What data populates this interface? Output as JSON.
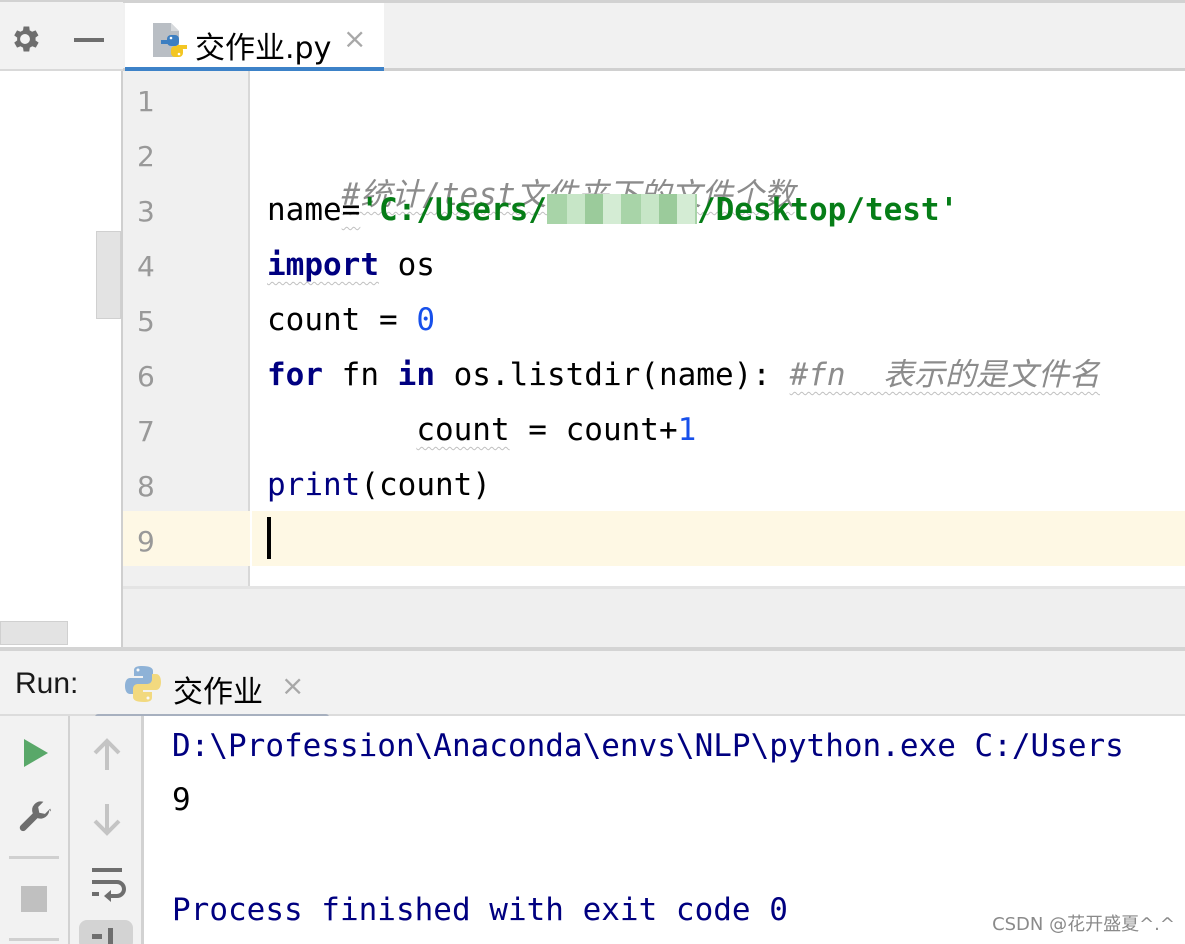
{
  "left_toolbar": {
    "settings_icon": "gear-icon",
    "minimize_icon": "minimize-icon"
  },
  "editor_tab": {
    "label": "交作业.py",
    "icon": "python-file-icon",
    "close": "×",
    "active": true
  },
  "editor": {
    "line_numbers": [
      "1",
      "2",
      "3",
      "4",
      "5",
      "6",
      "7",
      "8",
      "9"
    ],
    "current_line": 9,
    "lines": {
      "l2_comment": "#统计/test文件夹下的文件个数",
      "l3_var": "name",
      "l3_eq": "=",
      "l3_str_a": "'C:/Users/",
      "l3_str_b": "/Desktop/test'",
      "l4_kw": "import",
      "l4_rest": " os",
      "l5_a": "count = ",
      "l5_num": "0",
      "l6_kw1": "for",
      "l6_mid": " fn ",
      "l6_kw2": "in",
      "l6_rest": " os.listdir(name): ",
      "l6_comment": "#fn  表示的是文件名",
      "l7_indent": "        ",
      "l7_var": "count",
      "l7_rest": " = count+",
      "l7_num": "1",
      "l8_builtin": "print",
      "l8_rest": "(count)"
    }
  },
  "run_panel": {
    "label": "Run:",
    "tab_label": "交作业",
    "tab_close": "×",
    "tab_icon": "python-icon",
    "toolbar": [
      "run-icon",
      "wrench-icon",
      "stop-icon",
      "up-arrow-icon",
      "down-arrow-icon",
      "soft-wrap-icon",
      "scroll-to-end-icon"
    ],
    "console": {
      "command": "D:\\Profession\\Anaconda\\envs\\NLP\\python.exe C:/Users",
      "output": "9",
      "exit_message": "Process finished with exit code 0"
    }
  },
  "watermark": "CSDN @花开盛夏^.^",
  "colors": {
    "keyword": "#000080",
    "string": "#067d17",
    "number": "#1750eb",
    "comment": "#8c8c8c",
    "tab_accent": "#3d82c8",
    "current_line": "#fef8e4",
    "run_green": "#59a869"
  }
}
